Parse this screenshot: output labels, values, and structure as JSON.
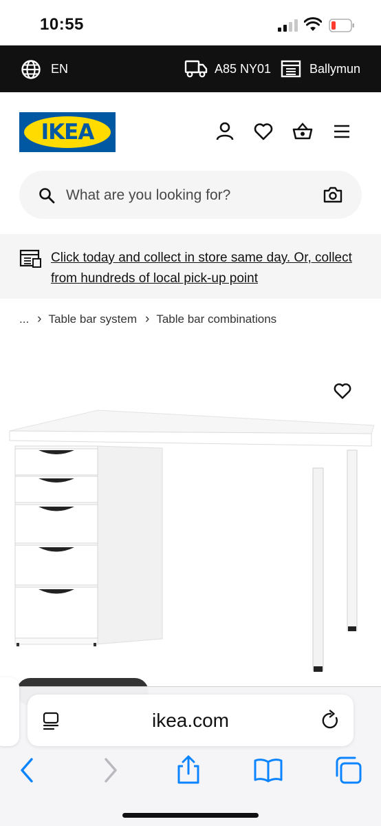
{
  "status_bar": {
    "time": "10:55"
  },
  "top_bar": {
    "language": "EN",
    "postcode": "A85 NY01",
    "store": "Ballymun"
  },
  "header": {
    "logo_text": "IKEA",
    "icons": [
      "user-icon",
      "heart-icon",
      "basket-icon",
      "menu-icon"
    ]
  },
  "search": {
    "placeholder": "What are you looking for?",
    "icons": [
      "search-icon",
      "camera-icon"
    ]
  },
  "banner": {
    "text": "Click today and collect in store same day. Or, collect from hundreds of local pick-up point"
  },
  "breadcrumb": {
    "items": [
      "...",
      "Table bar system",
      "Table bar combinations"
    ]
  },
  "product": {
    "image": "white desk with drawer unit"
  },
  "browser": {
    "url": "ikea.com",
    "toolbar_icons": [
      "back-icon",
      "forward-icon",
      "share-icon",
      "bookmarks-icon",
      "tabs-icon"
    ]
  },
  "colors": {
    "topbar": "#111111",
    "ikea_blue": "#0058a3",
    "ikea_yellow": "#ffdb00",
    "safari_blue": "#0a84ff",
    "battery_low": "#ff3b30"
  }
}
